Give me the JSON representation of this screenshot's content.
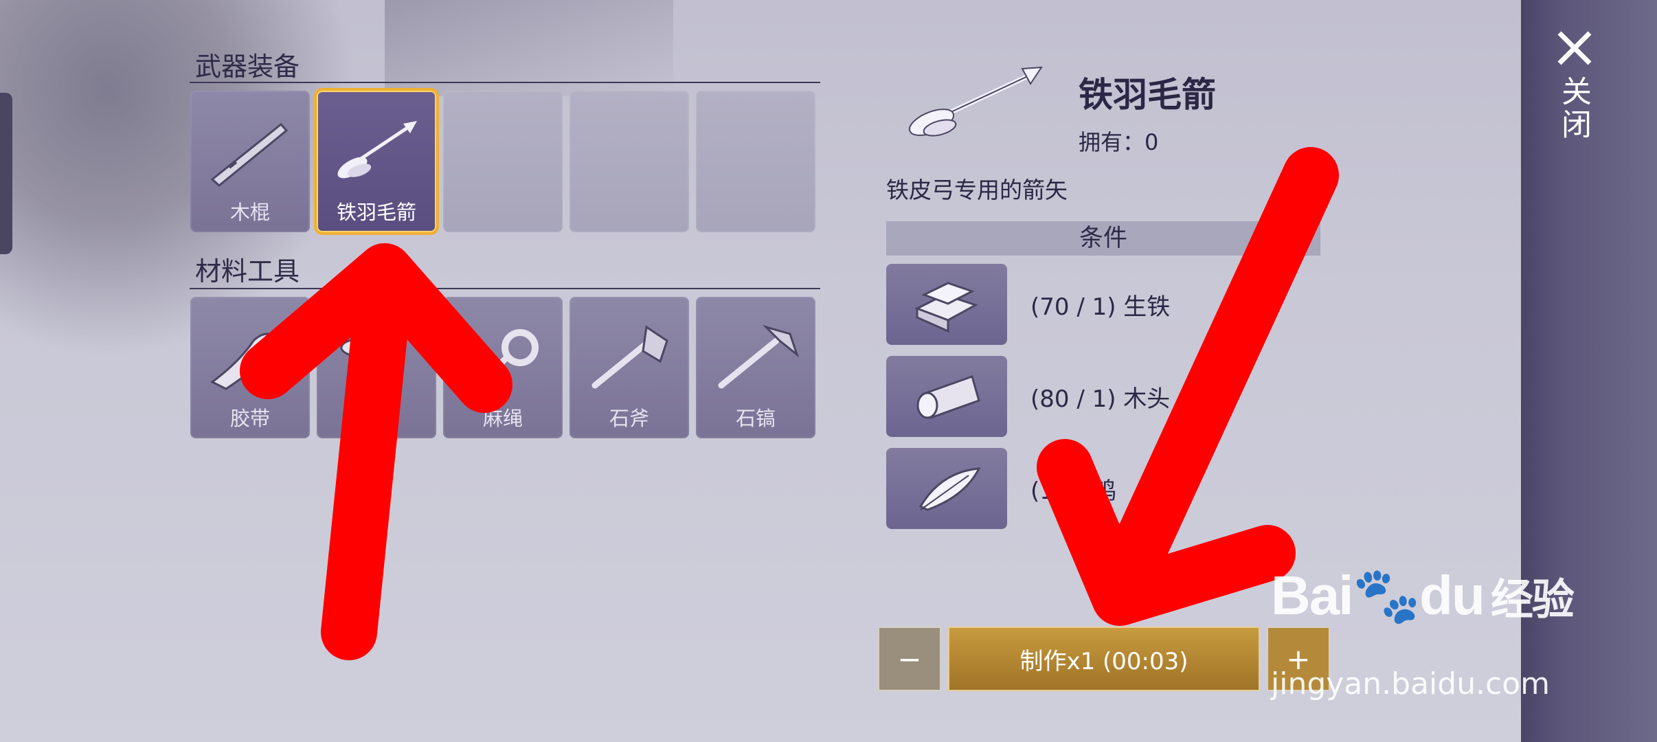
{
  "sections": {
    "weapons_title": "武器装备",
    "materials_title": "材料工具"
  },
  "weapons": [
    {
      "label": "木棍",
      "icon": "stick-icon"
    },
    {
      "label": "铁羽毛箭",
      "icon": "arrow-icon",
      "selected": true
    },
    {
      "label": ""
    },
    {
      "label": ""
    },
    {
      "label": ""
    }
  ],
  "materials": [
    {
      "label": "胶带",
      "icon": "tape-icon"
    },
    {
      "label": "",
      "icon": "nail-icon"
    },
    {
      "label": "麻绳",
      "icon": "rope-icon"
    },
    {
      "label": "石斧",
      "icon": "stone-axe-icon"
    },
    {
      "label": "石镐",
      "icon": "stone-pickaxe-icon"
    }
  ],
  "detail": {
    "name": "铁羽毛箭",
    "own_label": "拥有：",
    "own_value": "0",
    "description": "铁皮弓专用的箭矢",
    "conditions_title": "条件"
  },
  "requirements": [
    {
      "text": "(70 / 1) 生铁",
      "icon": "iron-ingot-icon"
    },
    {
      "text": "(80 / 1) 木头",
      "icon": "wood-log-icon"
    },
    {
      "text": "(1     1) 鸡",
      "icon": "feather-icon"
    }
  ],
  "craft": {
    "minus": "−",
    "label": "制作x1 (00:03)",
    "plus": "+"
  },
  "close": {
    "label": "关闭"
  },
  "watermark": {
    "logo": "Bai",
    "logo2": "du",
    "logo_cn": "经验",
    "url": "jingyan.baidu.com"
  },
  "colors": {
    "selected_border": "#f0b030",
    "craft_button": "#b08330",
    "annotation_arrow": "#ff0000"
  }
}
